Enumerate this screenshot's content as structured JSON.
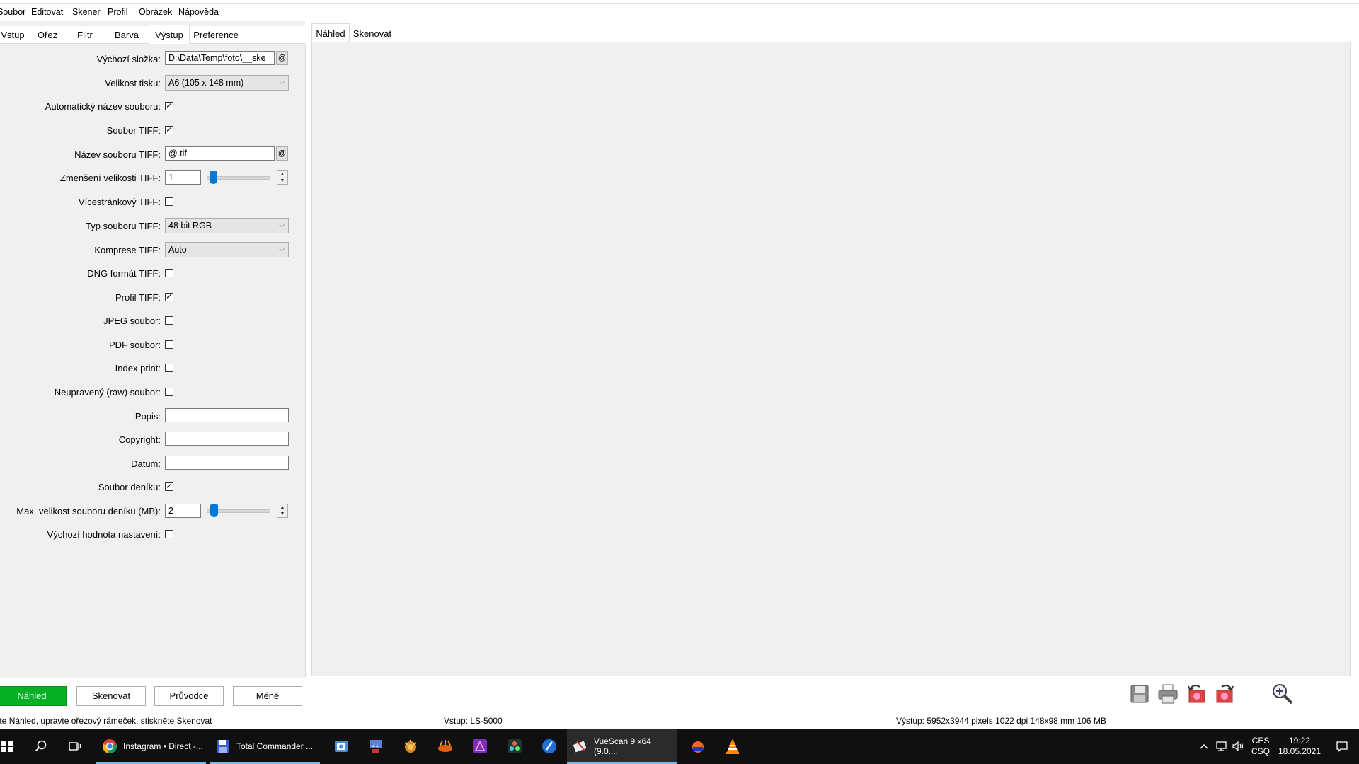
{
  "menu": [
    "Soubor",
    "Editovat",
    "Skener",
    "Profil",
    "Obrázek",
    "Nápověda"
  ],
  "left_tabs": [
    "Vstup",
    "Ořez",
    "Filtr",
    "Barva",
    "Výstup",
    "Preference"
  ],
  "active_left_tab": "Výstup",
  "form": {
    "default_folder_label": "Výchozí složka:",
    "default_folder_value": "D:\\Data\\Temp\\foto\\__ske",
    "print_size_label": "Velikost tisku:",
    "print_size_value": "A6 (105 x 148 mm)",
    "auto_filename_label": "Automatický název souboru:",
    "tiff_file_label": "Soubor TIFF:",
    "tiff_filename_label": "Název souboru TIFF:",
    "tiff_filename_value": "@.tif",
    "tiff_reduction_label": "Zmenšení velikosti TIFF:",
    "tiff_reduction_value": "1",
    "multipage_tiff_label": "Vícestránkový TIFF:",
    "tiff_type_label": "Typ souboru TIFF:",
    "tiff_type_value": "48 bit RGB",
    "tiff_compression_label": "Komprese TIFF:",
    "tiff_compression_value": "Auto",
    "dng_label": "DNG formát TIFF:",
    "tiff_profile_label": "Profil TIFF:",
    "jpeg_label": "JPEG soubor:",
    "pdf_label": "PDF soubor:",
    "index_print_label": "Index print:",
    "raw_label": "Neupravený (raw) soubor:",
    "description_label": "Popis:",
    "copyright_label": "Copyright:",
    "date_label": "Datum:",
    "log_file_label": "Soubor deníku:",
    "log_max_label": "Max. velikost souboru deníku (MB):",
    "log_max_value": "2",
    "default_settings_label": "Výchozí hodnota nastavení:",
    "at_symbol": "@",
    "checkmark": "✓",
    "spin_up": "▲",
    "spin_down": "▼",
    "dropdown_arrow": "⌵"
  },
  "checkboxes": {
    "auto_filename": true,
    "tiff_file": true,
    "multipage_tiff": false,
    "dng": false,
    "tiff_profile": true,
    "jpeg": false,
    "pdf": false,
    "index_print": false,
    "raw": false,
    "log_file": true,
    "default_settings": false
  },
  "right_tabs": [
    "Náhled",
    "Skenovat"
  ],
  "active_right_tab": "Náhled",
  "buttons": {
    "preview": "Náhled",
    "scan": "Skenovat",
    "wizard": "Průvodce",
    "less": "Méně"
  },
  "status": {
    "hint": "Stiskněte Náhled, upravte ořezový rámeček, stiskněte Skenovat",
    "input": "Vstup: LS-5000",
    "output": "Výstup: 5952x3944 pixels 1022 dpi 148x98 mm 106 MB"
  },
  "taskbar": {
    "apps": [
      {
        "label": "Instagram • Direct -...",
        "icon": "chrome-icon"
      },
      {
        "label": "Total Commander ...",
        "icon": "total-commander-icon"
      },
      {
        "label": "VueScan 9 x64 (9.0....",
        "icon": "vuescan-icon"
      }
    ],
    "lang_top": "CES",
    "lang_bottom": "CSQ",
    "time": "19:22",
    "date": "18.05.2021"
  }
}
